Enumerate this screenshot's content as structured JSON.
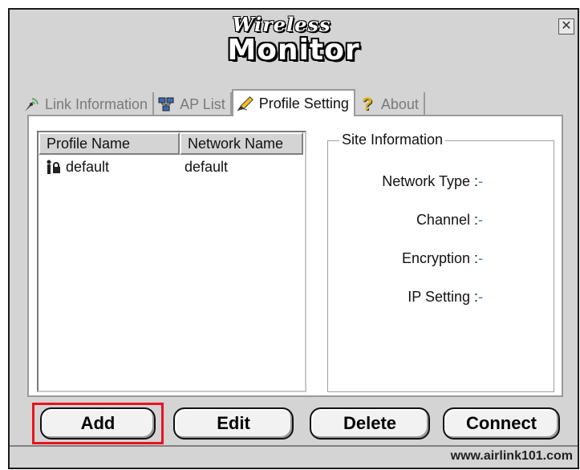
{
  "logo": {
    "line1": "Wireless",
    "line2": "Monitor"
  },
  "window": {
    "close_glyph": "✕"
  },
  "tabs": [
    {
      "label": "Link Information",
      "icon": "antenna-icon",
      "active": false
    },
    {
      "label": "AP List",
      "icon": "network-icon",
      "active": false
    },
    {
      "label": "Profile Setting",
      "icon": "pencil-icon",
      "active": true
    },
    {
      "label": "About",
      "icon": "question-mark-icon",
      "active": false
    }
  ],
  "profiles": {
    "columns": [
      "Profile Name",
      "Network Name"
    ],
    "rows": [
      {
        "profile": "default",
        "network": "default",
        "icon": "user-lock-icon"
      }
    ]
  },
  "site_info": {
    "title": "Site Information",
    "fields": [
      {
        "label": "Network Type :",
        "value": "-"
      },
      {
        "label": "Channel :",
        "value": "-"
      },
      {
        "label": "Encryption :",
        "value": "-"
      },
      {
        "label": "IP Setting :",
        "value": "-"
      }
    ]
  },
  "buttons": {
    "add": "Add",
    "edit": "Edit",
    "delete": "Delete",
    "connect": "Connect"
  },
  "footer": {
    "url": "www.airlink101.com"
  },
  "colors": {
    "highlight": "#e8141e",
    "value_blue": "#3a78c8",
    "window_bg": "#d4d4d4"
  }
}
